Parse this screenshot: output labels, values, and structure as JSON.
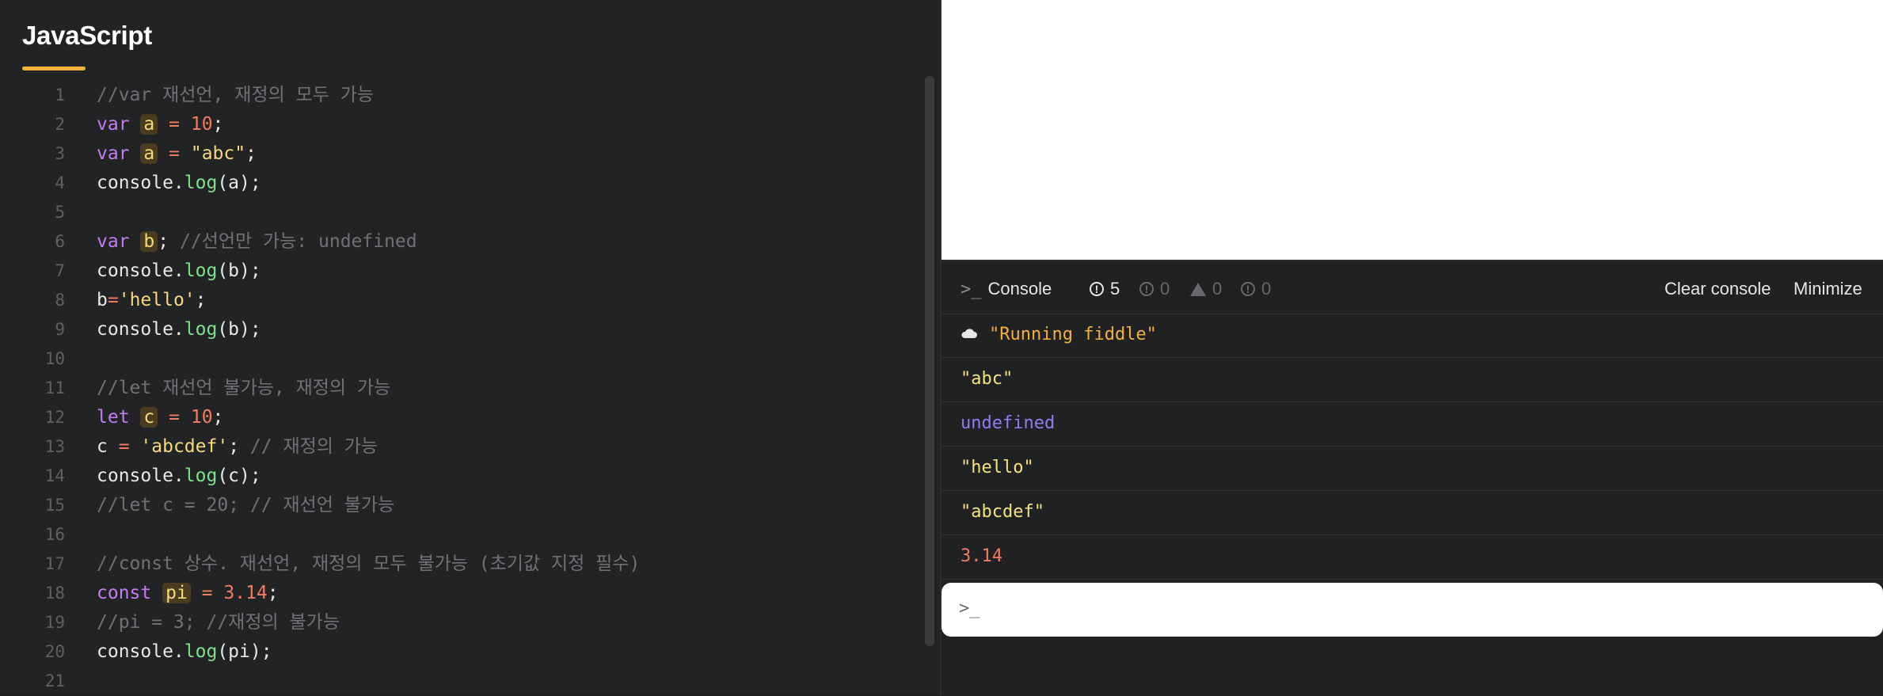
{
  "editor": {
    "title": "JavaScript",
    "lines": [
      {
        "n": "1",
        "tokens": [
          {
            "t": "//var 재선언, 재정의 모두 가능",
            "c": "cm"
          }
        ]
      },
      {
        "n": "2",
        "tokens": [
          {
            "t": "var",
            "c": "kw"
          },
          {
            "t": " "
          },
          {
            "t": "a",
            "c": "hl"
          },
          {
            "t": " "
          },
          {
            "t": "=",
            "c": "op"
          },
          {
            "t": " "
          },
          {
            "t": "10",
            "c": "num"
          },
          {
            "t": ";"
          }
        ]
      },
      {
        "n": "3",
        "tokens": [
          {
            "t": "var",
            "c": "kw"
          },
          {
            "t": " "
          },
          {
            "t": "a",
            "c": "hl"
          },
          {
            "t": " "
          },
          {
            "t": "=",
            "c": "op"
          },
          {
            "t": " "
          },
          {
            "t": "\"abc\"",
            "c": "str"
          },
          {
            "t": ";"
          }
        ]
      },
      {
        "n": "4",
        "tokens": [
          {
            "t": "console."
          },
          {
            "t": "log",
            "c": "fn"
          },
          {
            "t": "(a);"
          }
        ]
      },
      {
        "n": "5",
        "tokens": []
      },
      {
        "n": "6",
        "tokens": [
          {
            "t": "var",
            "c": "kw"
          },
          {
            "t": " "
          },
          {
            "t": "b",
            "c": "hl"
          },
          {
            "t": "; "
          },
          {
            "t": "//선언만 가능: undefined",
            "c": "cm"
          }
        ]
      },
      {
        "n": "7",
        "tokens": [
          {
            "t": "console."
          },
          {
            "t": "log",
            "c": "fn"
          },
          {
            "t": "(b);"
          }
        ]
      },
      {
        "n": "8",
        "tokens": [
          {
            "t": "b"
          },
          {
            "t": "=",
            "c": "op"
          },
          {
            "t": "'hello'",
            "c": "str"
          },
          {
            "t": ";"
          }
        ]
      },
      {
        "n": "9",
        "tokens": [
          {
            "t": "console."
          },
          {
            "t": "log",
            "c": "fn"
          },
          {
            "t": "(b);"
          }
        ]
      },
      {
        "n": "10",
        "tokens": []
      },
      {
        "n": "11",
        "tokens": [
          {
            "t": "//let 재선언 불가능, 재정의 가능",
            "c": "cm"
          }
        ]
      },
      {
        "n": "12",
        "tokens": [
          {
            "t": "let",
            "c": "kw"
          },
          {
            "t": " "
          },
          {
            "t": "c",
            "c": "hl"
          },
          {
            "t": " "
          },
          {
            "t": "=",
            "c": "op"
          },
          {
            "t": " "
          },
          {
            "t": "10",
            "c": "num"
          },
          {
            "t": ";"
          }
        ]
      },
      {
        "n": "13",
        "tokens": [
          {
            "t": "c "
          },
          {
            "t": "=",
            "c": "op"
          },
          {
            "t": " "
          },
          {
            "t": "'abcdef'",
            "c": "str"
          },
          {
            "t": "; "
          },
          {
            "t": "// 재정의 가능",
            "c": "cm"
          }
        ]
      },
      {
        "n": "14",
        "tokens": [
          {
            "t": "console."
          },
          {
            "t": "log",
            "c": "fn"
          },
          {
            "t": "(c);"
          }
        ]
      },
      {
        "n": "15",
        "tokens": [
          {
            "t": "//let c = 20; // 재선언 불가능",
            "c": "cm"
          }
        ]
      },
      {
        "n": "16",
        "tokens": []
      },
      {
        "n": "17",
        "tokens": [
          {
            "t": "//const 상수. 재선언, 재정의 모두 불가능 (초기값 지정 필수)",
            "c": "cm"
          }
        ]
      },
      {
        "n": "18",
        "tokens": [
          {
            "t": "const",
            "c": "kw"
          },
          {
            "t": " "
          },
          {
            "t": "pi",
            "c": "hl"
          },
          {
            "t": " "
          },
          {
            "t": "=",
            "c": "op"
          },
          {
            "t": " "
          },
          {
            "t": "3.14",
            "c": "num"
          },
          {
            "t": ";"
          }
        ]
      },
      {
        "n": "19",
        "tokens": [
          {
            "t": "//pi = 3; //재정의 불가능",
            "c": "cm"
          }
        ]
      },
      {
        "n": "20",
        "tokens": [
          {
            "t": "console."
          },
          {
            "t": "log",
            "c": "fn"
          },
          {
            "t": "(pi);"
          }
        ]
      },
      {
        "n": "21",
        "tokens": []
      }
    ]
  },
  "console": {
    "title": "Console",
    "prompt_glyph": ">_",
    "log_count": "5",
    "info_count": "0",
    "warn_count": "0",
    "error_count": "0",
    "clear_label": "Clear console",
    "minimize_label": "Minimize",
    "rows": [
      {
        "text": "\"Running fiddle\"",
        "color": "#f2b13a",
        "icon": "cloud-icon"
      },
      {
        "text": "\"abc\"",
        "color": "#f6e27a"
      },
      {
        "text": "undefined",
        "color": "#8f7cf2"
      },
      {
        "text": "\"hello\"",
        "color": "#f6e27a"
      },
      {
        "text": "\"abcdef\"",
        "color": "#f6e27a"
      },
      {
        "text": "3.14",
        "color": "#f07d60"
      }
    ],
    "input_prompt": ">_"
  }
}
